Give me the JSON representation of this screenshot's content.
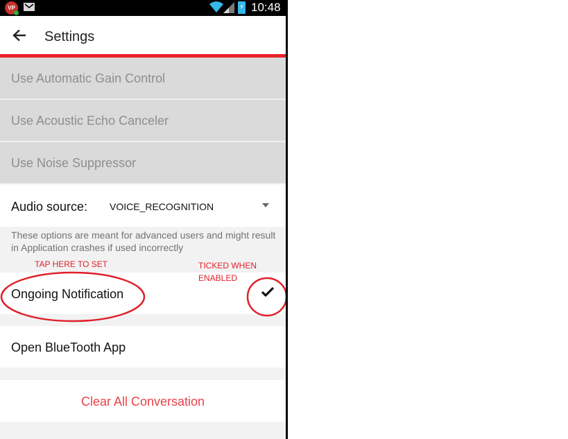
{
  "status_bar": {
    "app_icon_text": "VP",
    "time": "10:48",
    "icons": [
      "app-notification-icon",
      "mail-icon",
      "wifi-icon",
      "signal-icon",
      "battery-charging-icon"
    ]
  },
  "toolbar": {
    "title": "Settings",
    "back_icon": "arrow-left-icon"
  },
  "settings": {
    "disabled_items": [
      {
        "label": "Use Automatic Gain Control"
      },
      {
        "label": "Use Acoustic Echo Canceler"
      },
      {
        "label": "Use Noise Suppressor"
      }
    ],
    "audio_source": {
      "label": "Audio source:",
      "selected": "VOICE_RECOGNITION"
    },
    "advanced_note": "These options are meant for advanced users and might result in Application crashes if used incorrectly",
    "ongoing_notification": {
      "label": "Ongoing Notification",
      "checked": true
    },
    "bluetooth": {
      "label": "Open BlueTooth App"
    },
    "clear": {
      "label": "Clear All Conversation"
    }
  },
  "annotations": {
    "tap_here": "TAP HERE TO SET",
    "ticked_when": "TICKED WHEN",
    "enabled": "ENABLED"
  },
  "colors": {
    "accent": "#e8202a",
    "clear_text": "#e8424a",
    "annotation": "#e0202a",
    "disabled_bg": "#dadada",
    "battery": "#35b7e8"
  }
}
